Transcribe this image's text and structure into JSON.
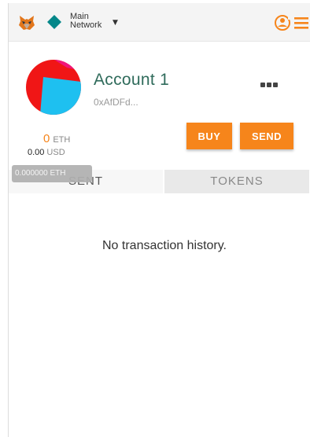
{
  "header": {
    "network_line1": "Main",
    "network_line2": "Network"
  },
  "account": {
    "name": "Account 1",
    "address": "0xAfDFd..."
  },
  "balance": {
    "eth_value": "0",
    "eth_unit": "ETH",
    "usd_value": "0.00",
    "usd_unit": "USD",
    "tooltip": "0.000000 ETH"
  },
  "actions": {
    "buy_label": "BUY",
    "send_label": "SEND"
  },
  "tabs": [
    {
      "label": "SENT",
      "active": true
    },
    {
      "label": "TOKENS",
      "active": false
    }
  ],
  "empty_state": "No transaction history.",
  "colors": {
    "accent": "#f6851b",
    "account_name": "#2f6b5b",
    "network_diamond": "#038789"
  },
  "icons": [
    "metamask-fox-icon",
    "network-diamond-icon",
    "chevron-down-icon",
    "account-switch-icon",
    "hamburger-menu-icon",
    "more-options-icon"
  ]
}
